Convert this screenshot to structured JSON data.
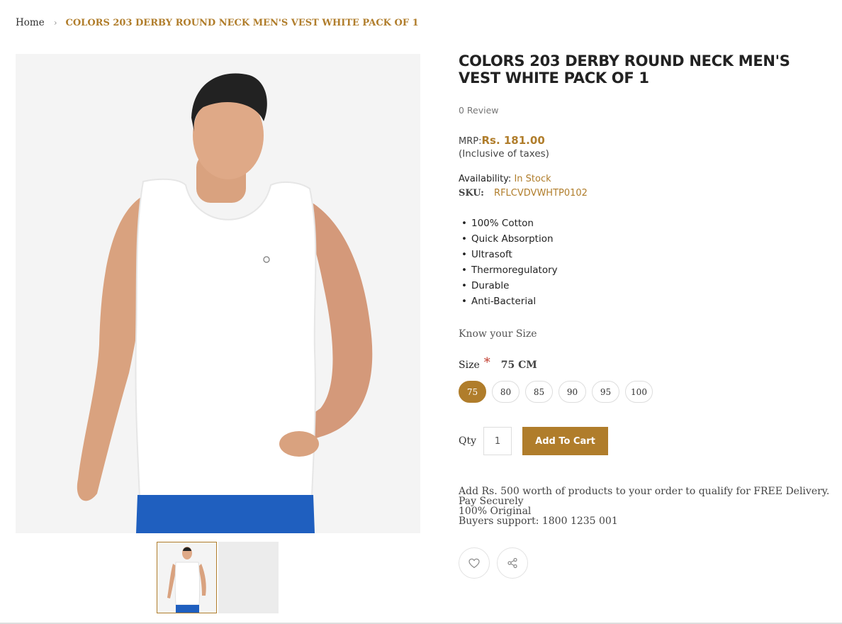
{
  "breadcrumb": {
    "home": "Home",
    "separator": "›",
    "current": "COLORS 203 DERBY ROUND NECK MEN'S VEST WHITE PACK OF 1"
  },
  "product": {
    "title": "COLORS 203 DERBY ROUND NECK MEN'S VEST WHITE PACK OF 1",
    "reviews": "0 Review",
    "mrp_label": "MRP:",
    "price": "Rs. 181.00",
    "tax_note": "(Inclusive of taxes)",
    "availability_label": "Availability:",
    "availability_value": "In Stock",
    "sku_label": "SKU:",
    "sku_value": "RFLCVDVWHTP0102",
    "features": [
      "100% Cotton",
      "Quick Absorption",
      "Ultrasoft",
      "Thermoregulatory",
      "Durable",
      "Anti-Bacterial"
    ]
  },
  "size": {
    "know_your_size": "Know your Size",
    "label": "Size",
    "required_mark": "*",
    "selected": "75 CM",
    "options": [
      "75",
      "80",
      "85",
      "90",
      "95",
      "100"
    ],
    "active_option": "75"
  },
  "cart": {
    "qty_label": "Qty",
    "qty_value": "1",
    "add_to_cart": "Add To Cart"
  },
  "notes": {
    "delivery": "Add Rs. 500 worth of products to your order to qualify for FREE Delivery.",
    "secure": "Pay Securely",
    "original": "100% Original",
    "support": "Buyers support: 1800 1235 001"
  },
  "icons": {
    "wishlist": "heart-icon",
    "share": "share-icon",
    "breadcrumb_separator": "chevron-right-icon"
  },
  "colors": {
    "accent": "#b07d2b",
    "vest": "#ffffff",
    "shorts": "#1f5fbf",
    "skin": "#d9a27f",
    "background": "#f4f4f4"
  }
}
